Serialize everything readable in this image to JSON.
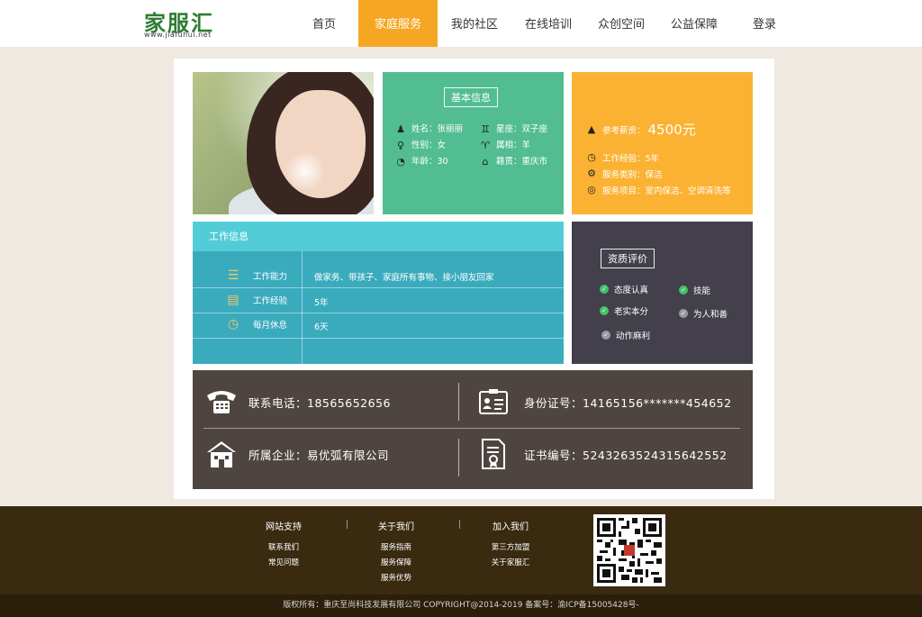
{
  "header": {
    "logo_text": "家服汇",
    "logo_url": "www.jiafuhui.net",
    "nav": [
      {
        "label": "首页",
        "active": false
      },
      {
        "label": "家庭服务",
        "active": true
      },
      {
        "label": "我的社区",
        "active": false
      },
      {
        "label": "在线培训",
        "active": false
      },
      {
        "label": "众创空间",
        "active": false
      },
      {
        "label": "公益保障",
        "active": false
      },
      {
        "label": "登录",
        "active": false
      }
    ]
  },
  "basic_info": {
    "title": "基本信息",
    "name": "姓名：张丽丽",
    "zodiac": "星座：双子座",
    "gender": "性别：女",
    "animal": "属相：羊",
    "age": "年龄：30",
    "hometown": "籍贯：重庆市"
  },
  "salary_info": {
    "salary_label": "参考薪资：",
    "salary_value": "4500元",
    "experience": "工作经验：5年",
    "category": "服务类别：保洁",
    "items": "服务项目：室内保洁、空调清洗等"
  },
  "work_info": {
    "title": "工作信息",
    "rows": [
      {
        "label": "工作能力",
        "value": "做家务、带孩子、家庭所有事物、接小朋友回家"
      },
      {
        "label": "工作经验",
        "value": "5年"
      },
      {
        "label": "每月休息",
        "value": "6天"
      }
    ]
  },
  "qualification": {
    "title": "资质评价",
    "items": [
      {
        "label": "态度认真",
        "checked": true
      },
      {
        "label": "技能",
        "checked": true
      },
      {
        "label": "老实本分",
        "checked": true
      },
      {
        "label": "为人和善",
        "checked": false
      },
      {
        "label": "动作麻利",
        "checked": false
      }
    ]
  },
  "contact": {
    "phone": "联系电话：18565652656",
    "id_card": "身份证号：14165156*******454652",
    "company": "所属企业：易优弧有限公司",
    "certificate": "证书编号：5243263524315642552"
  },
  "footer": {
    "columns": [
      {
        "title": "网站支持",
        "links": [
          "联系我们",
          "常见问题"
        ]
      },
      {
        "title": "关于我们",
        "links": [
          "服务指南",
          "服务保障",
          "服务优势"
        ]
      },
      {
        "title": "加入我们",
        "links": [
          "第三方加盟",
          "关于家服汇"
        ]
      }
    ],
    "copyright": "版权所有：重庆至尚科技发展有限公司 COPYRIGHT@2014-2019 备案号：渝ICP备15005428号-"
  },
  "colors": {
    "accent_orange": "#f5a623",
    "green_card": "#52bd92",
    "yellow_card": "#fbb233",
    "teal_card": "#3aabbd",
    "dark_card": "#43404b",
    "brown_card": "#4f4540",
    "footer_bg": "#3a2a10"
  }
}
